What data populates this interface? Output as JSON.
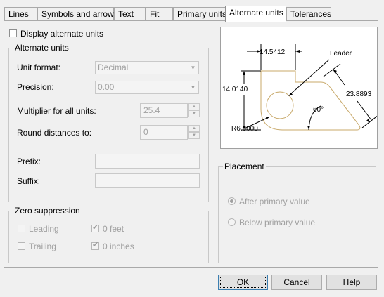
{
  "tabs": [
    "Lines",
    "Symbols and arrows",
    "Text",
    "Fit",
    "Primary units",
    "Alternate units",
    "Tolerances"
  ],
  "active_tab": "Alternate units",
  "display_alternate": {
    "label": "Display alternate units",
    "checked": false
  },
  "alternate_units": {
    "title": "Alternate units",
    "unit_format": {
      "label": "Unit format:",
      "value": "Decimal"
    },
    "precision": {
      "label": "Precision:",
      "value": "0.00"
    },
    "multiplier": {
      "label": "Multiplier for all units:",
      "value": "25.4"
    },
    "round": {
      "label": "Round distances to:",
      "value": "0"
    },
    "prefix": {
      "label": "Prefix:",
      "value": ""
    },
    "suffix": {
      "label": "Suffix:",
      "value": ""
    }
  },
  "zero_suppression": {
    "title": "Zero suppression",
    "leading": {
      "label": "Leading",
      "checked": false
    },
    "trailing": {
      "label": "Trailing",
      "checked": false
    },
    "zero_feet": {
      "label": "0 feet",
      "checked": true
    },
    "zero_inches": {
      "label": "0 inches",
      "checked": true
    }
  },
  "placement": {
    "title": "Placement",
    "after": {
      "label": "After primary value",
      "selected": true
    },
    "below": {
      "label": "Below primary value",
      "selected": false
    }
  },
  "preview": {
    "dim_top": "14.5412",
    "dim_left": "14.0140",
    "dim_right": "23.8893",
    "radius": "R6.0000",
    "angle": "60°",
    "leader": "Leader"
  },
  "buttons": {
    "ok": "OK",
    "cancel": "Cancel",
    "help": "Help"
  },
  "colors": {
    "shape": "#c8a96a",
    "disabled_text": "#a0a0a0"
  }
}
